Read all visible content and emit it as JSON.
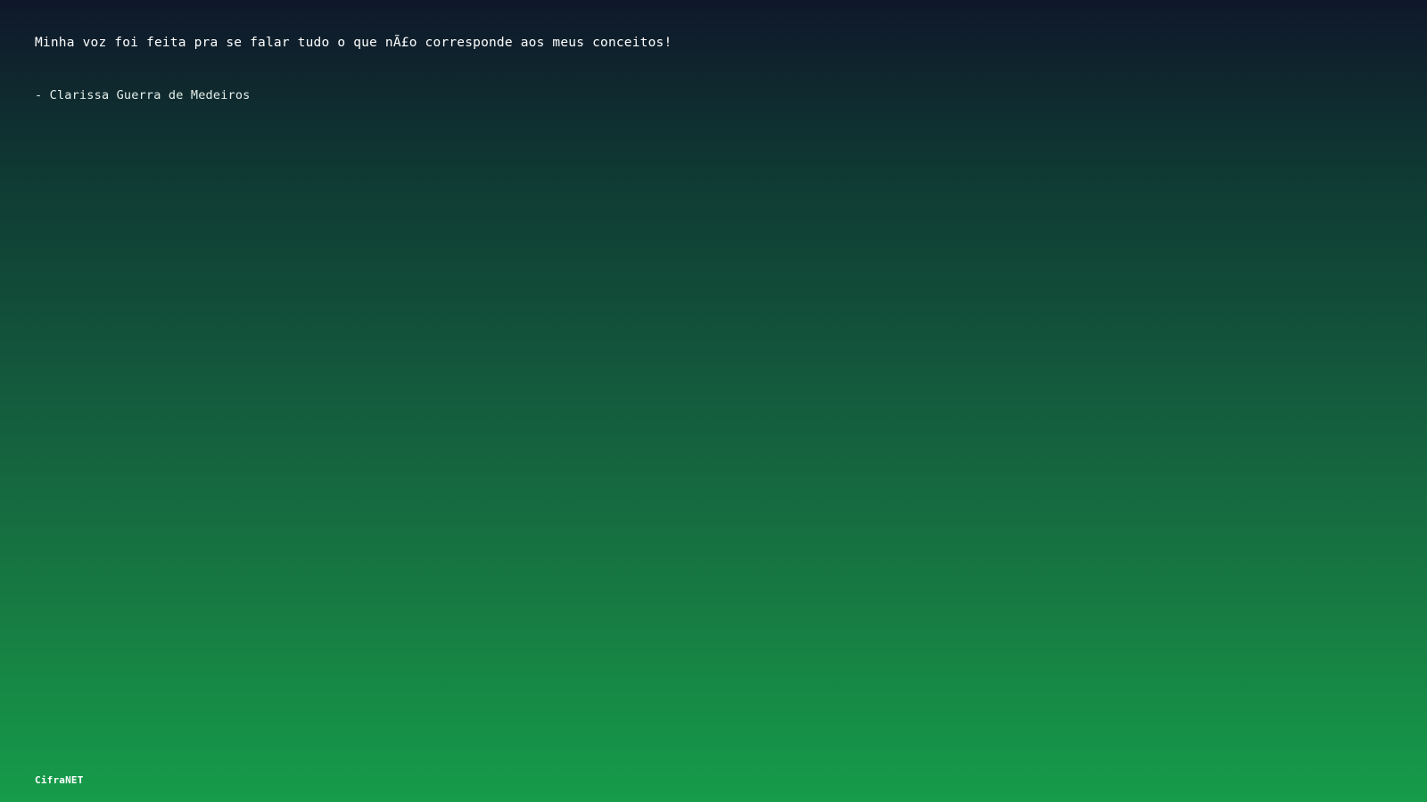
{
  "quote": {
    "text": "Minha voz foi feita pra se falar tudo o que nÃ£o corresponde aos meus conceitos!",
    "author": "- Clarissa Guerra de Medeiros"
  },
  "brand": {
    "name": "CifraNET"
  },
  "colors": {
    "gradient_top": "#0f172a",
    "gradient_bottom": "#169c4a",
    "text": "#ffffff"
  }
}
